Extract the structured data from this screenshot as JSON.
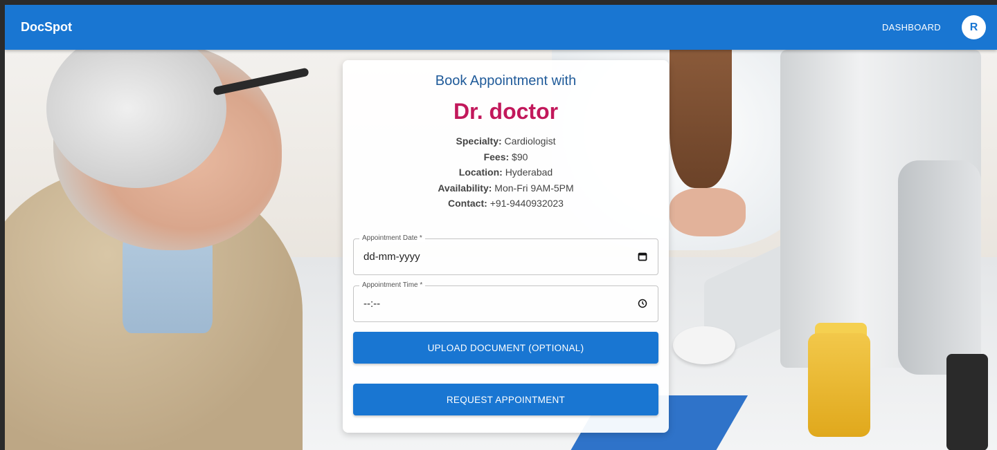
{
  "app": {
    "brand": "DocSpot"
  },
  "nav": {
    "dashboard_label": "DASHBOARD",
    "avatar_initial": "R"
  },
  "booking": {
    "heading": "Book Appointment with",
    "doctor_name": "Dr. doctor",
    "details": [
      {
        "label": "Specialty:",
        "value": "Cardiologist"
      },
      {
        "label": "Fees:",
        "value": "$90"
      },
      {
        "label": "Location:",
        "value": "Hyderabad"
      },
      {
        "label": "Availability:",
        "value": "Mon-Fri 9AM-5PM"
      },
      {
        "label": "Contact:",
        "value": "+91-9440932023"
      }
    ],
    "date_field": {
      "label": "Appointment Date *",
      "value": "dd-mm-yyyy",
      "icon": "calendar-icon"
    },
    "time_field": {
      "label": "Appointment Time *",
      "value": "--:--",
      "icon": "clock-icon"
    },
    "upload_label": "UPLOAD DOCUMENT (OPTIONAL)",
    "submit_label": "REQUEST APPOINTMENT"
  },
  "colors": {
    "appbar": "#1976d2",
    "doctor_name": "#c2185b",
    "heading": "#1f5a99",
    "button": "#1976d2"
  }
}
